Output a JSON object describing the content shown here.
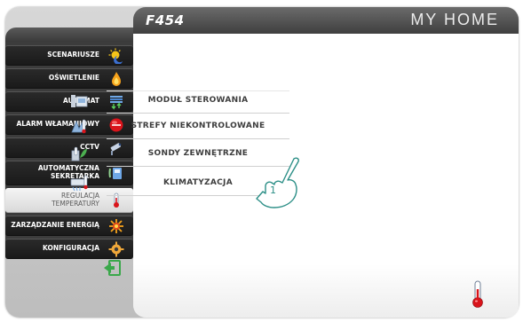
{
  "header": {
    "model": "F454",
    "brand": "MY HOME"
  },
  "sidebar": {
    "items": [
      {
        "label": "SCENARIUSZE",
        "icon": "scenarios-sun-icon"
      },
      {
        "label": "OŚWIETLENIE",
        "icon": "lighting-flame-icon"
      },
      {
        "label": "AUTOMAT",
        "icon": "automation-blinds-icon"
      },
      {
        "label": "ALARM WŁAMANIOWY",
        "icon": "burglar-alarm-icon"
      },
      {
        "label": "CCTV",
        "icon": "cctv-camera-icon"
      },
      {
        "label": "AUTOMATYCZNA SEKRETARKA",
        "icon": "answering-machine-icon"
      },
      {
        "label": "REGULACJA TEMPERATURY",
        "icon": "thermometer-icon",
        "active": true
      },
      {
        "label": "ZARZĄDZANIE ENERGIĄ",
        "icon": "energy-management-icon"
      },
      {
        "label": "KONFIGURACJA",
        "icon": "configuration-gear-icon"
      }
    ],
    "back": "back-exit-icon"
  },
  "main": {
    "options": [
      {
        "label": "MODUŁ STEROWANIA",
        "icon": "control-module-icon"
      },
      {
        "label": "STREFY NIEKONTROLOWANE",
        "icon": "uncontrolled-zones-icon"
      },
      {
        "label": "SONDY ZEWNĘTRZNE",
        "icon": "external-probes-icon"
      },
      {
        "label": "KLIMATYZACJA",
        "icon": "air-conditioning-icon"
      }
    ],
    "callout_number": "1",
    "section_icon": "thermometer-icon"
  },
  "colors": {
    "accent_teal": "#2c8f87",
    "sidebar_dark": "#1f1f1f",
    "header_dark": "#4a4a4a"
  }
}
